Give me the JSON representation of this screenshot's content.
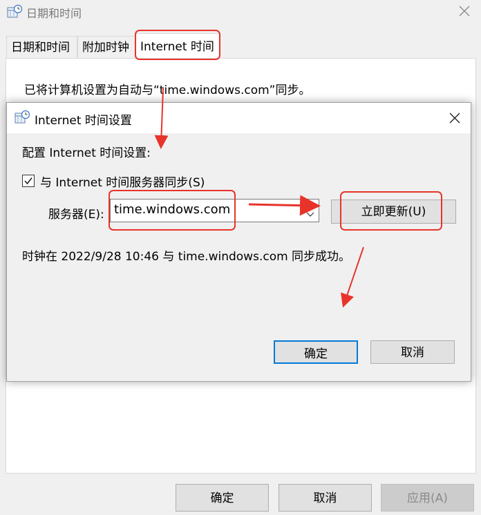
{
  "outer": {
    "title": "日期和时间",
    "tabs": [
      {
        "label": "日期和时间"
      },
      {
        "label": "附加时钟"
      },
      {
        "label": "Internet 时间"
      }
    ],
    "description": "已将计算机设置为自动与“time.windows.com”同步。",
    "buttons": {
      "ok": "确定",
      "cancel": "取消",
      "apply": "应用(A)"
    }
  },
  "inner": {
    "title": "Internet 时间设置",
    "config_label": "配置 Internet 时间设置:",
    "sync_checkbox_label": "与 Internet 时间服务器同步(S)",
    "sync_checked": true,
    "server_label": "服务器(E):",
    "server_value": "time.windows.com",
    "update_button": "立即更新(U)",
    "status": "时钟在 2022/9/28 10:46 与 time.windows.com 同步成功。",
    "buttons": {
      "ok": "确定",
      "cancel": "取消"
    }
  },
  "colors": {
    "annotation": "#e8332a",
    "focus": "#0078d7"
  },
  "icons": {
    "window": "clock-calendar-icon",
    "close": "close-icon"
  }
}
